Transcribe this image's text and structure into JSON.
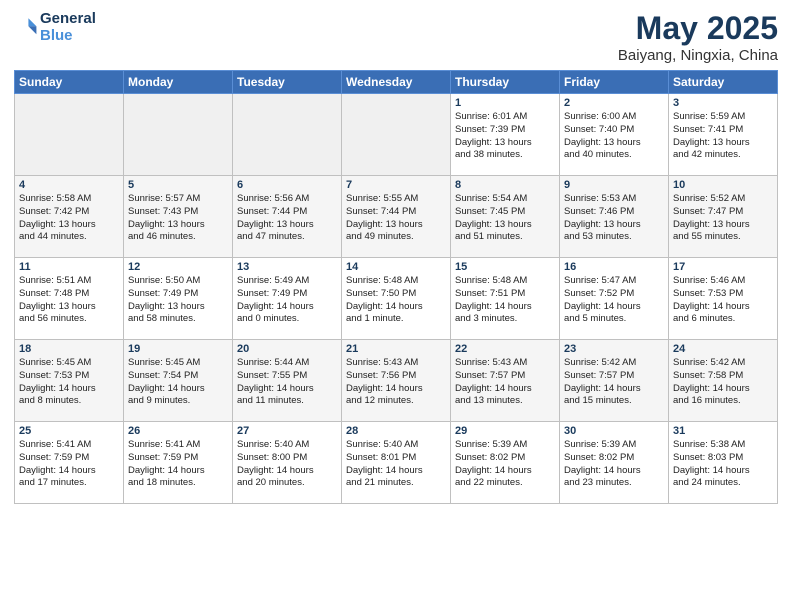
{
  "logo": {
    "line1": "General",
    "line2": "Blue"
  },
  "title": "May 2025",
  "location": "Baiyang, Ningxia, China",
  "days_of_week": [
    "Sunday",
    "Monday",
    "Tuesday",
    "Wednesday",
    "Thursday",
    "Friday",
    "Saturday"
  ],
  "weeks": [
    [
      {
        "day": "",
        "text": ""
      },
      {
        "day": "",
        "text": ""
      },
      {
        "day": "",
        "text": ""
      },
      {
        "day": "",
        "text": ""
      },
      {
        "day": "1",
        "text": "Sunrise: 6:01 AM\nSunset: 7:39 PM\nDaylight: 13 hours\nand 38 minutes."
      },
      {
        "day": "2",
        "text": "Sunrise: 6:00 AM\nSunset: 7:40 PM\nDaylight: 13 hours\nand 40 minutes."
      },
      {
        "day": "3",
        "text": "Sunrise: 5:59 AM\nSunset: 7:41 PM\nDaylight: 13 hours\nand 42 minutes."
      }
    ],
    [
      {
        "day": "4",
        "text": "Sunrise: 5:58 AM\nSunset: 7:42 PM\nDaylight: 13 hours\nand 44 minutes."
      },
      {
        "day": "5",
        "text": "Sunrise: 5:57 AM\nSunset: 7:43 PM\nDaylight: 13 hours\nand 46 minutes."
      },
      {
        "day": "6",
        "text": "Sunrise: 5:56 AM\nSunset: 7:44 PM\nDaylight: 13 hours\nand 47 minutes."
      },
      {
        "day": "7",
        "text": "Sunrise: 5:55 AM\nSunset: 7:44 PM\nDaylight: 13 hours\nand 49 minutes."
      },
      {
        "day": "8",
        "text": "Sunrise: 5:54 AM\nSunset: 7:45 PM\nDaylight: 13 hours\nand 51 minutes."
      },
      {
        "day": "9",
        "text": "Sunrise: 5:53 AM\nSunset: 7:46 PM\nDaylight: 13 hours\nand 53 minutes."
      },
      {
        "day": "10",
        "text": "Sunrise: 5:52 AM\nSunset: 7:47 PM\nDaylight: 13 hours\nand 55 minutes."
      }
    ],
    [
      {
        "day": "11",
        "text": "Sunrise: 5:51 AM\nSunset: 7:48 PM\nDaylight: 13 hours\nand 56 minutes."
      },
      {
        "day": "12",
        "text": "Sunrise: 5:50 AM\nSunset: 7:49 PM\nDaylight: 13 hours\nand 58 minutes."
      },
      {
        "day": "13",
        "text": "Sunrise: 5:49 AM\nSunset: 7:49 PM\nDaylight: 14 hours\nand 0 minutes."
      },
      {
        "day": "14",
        "text": "Sunrise: 5:48 AM\nSunset: 7:50 PM\nDaylight: 14 hours\nand 1 minute."
      },
      {
        "day": "15",
        "text": "Sunrise: 5:48 AM\nSunset: 7:51 PM\nDaylight: 14 hours\nand 3 minutes."
      },
      {
        "day": "16",
        "text": "Sunrise: 5:47 AM\nSunset: 7:52 PM\nDaylight: 14 hours\nand 5 minutes."
      },
      {
        "day": "17",
        "text": "Sunrise: 5:46 AM\nSunset: 7:53 PM\nDaylight: 14 hours\nand 6 minutes."
      }
    ],
    [
      {
        "day": "18",
        "text": "Sunrise: 5:45 AM\nSunset: 7:53 PM\nDaylight: 14 hours\nand 8 minutes."
      },
      {
        "day": "19",
        "text": "Sunrise: 5:45 AM\nSunset: 7:54 PM\nDaylight: 14 hours\nand 9 minutes."
      },
      {
        "day": "20",
        "text": "Sunrise: 5:44 AM\nSunset: 7:55 PM\nDaylight: 14 hours\nand 11 minutes."
      },
      {
        "day": "21",
        "text": "Sunrise: 5:43 AM\nSunset: 7:56 PM\nDaylight: 14 hours\nand 12 minutes."
      },
      {
        "day": "22",
        "text": "Sunrise: 5:43 AM\nSunset: 7:57 PM\nDaylight: 14 hours\nand 13 minutes."
      },
      {
        "day": "23",
        "text": "Sunrise: 5:42 AM\nSunset: 7:57 PM\nDaylight: 14 hours\nand 15 minutes."
      },
      {
        "day": "24",
        "text": "Sunrise: 5:42 AM\nSunset: 7:58 PM\nDaylight: 14 hours\nand 16 minutes."
      }
    ],
    [
      {
        "day": "25",
        "text": "Sunrise: 5:41 AM\nSunset: 7:59 PM\nDaylight: 14 hours\nand 17 minutes."
      },
      {
        "day": "26",
        "text": "Sunrise: 5:41 AM\nSunset: 7:59 PM\nDaylight: 14 hours\nand 18 minutes."
      },
      {
        "day": "27",
        "text": "Sunrise: 5:40 AM\nSunset: 8:00 PM\nDaylight: 14 hours\nand 20 minutes."
      },
      {
        "day": "28",
        "text": "Sunrise: 5:40 AM\nSunset: 8:01 PM\nDaylight: 14 hours\nand 21 minutes."
      },
      {
        "day": "29",
        "text": "Sunrise: 5:39 AM\nSunset: 8:02 PM\nDaylight: 14 hours\nand 22 minutes."
      },
      {
        "day": "30",
        "text": "Sunrise: 5:39 AM\nSunset: 8:02 PM\nDaylight: 14 hours\nand 23 minutes."
      },
      {
        "day": "31",
        "text": "Sunrise: 5:38 AM\nSunset: 8:03 PM\nDaylight: 14 hours\nand 24 minutes."
      }
    ]
  ]
}
